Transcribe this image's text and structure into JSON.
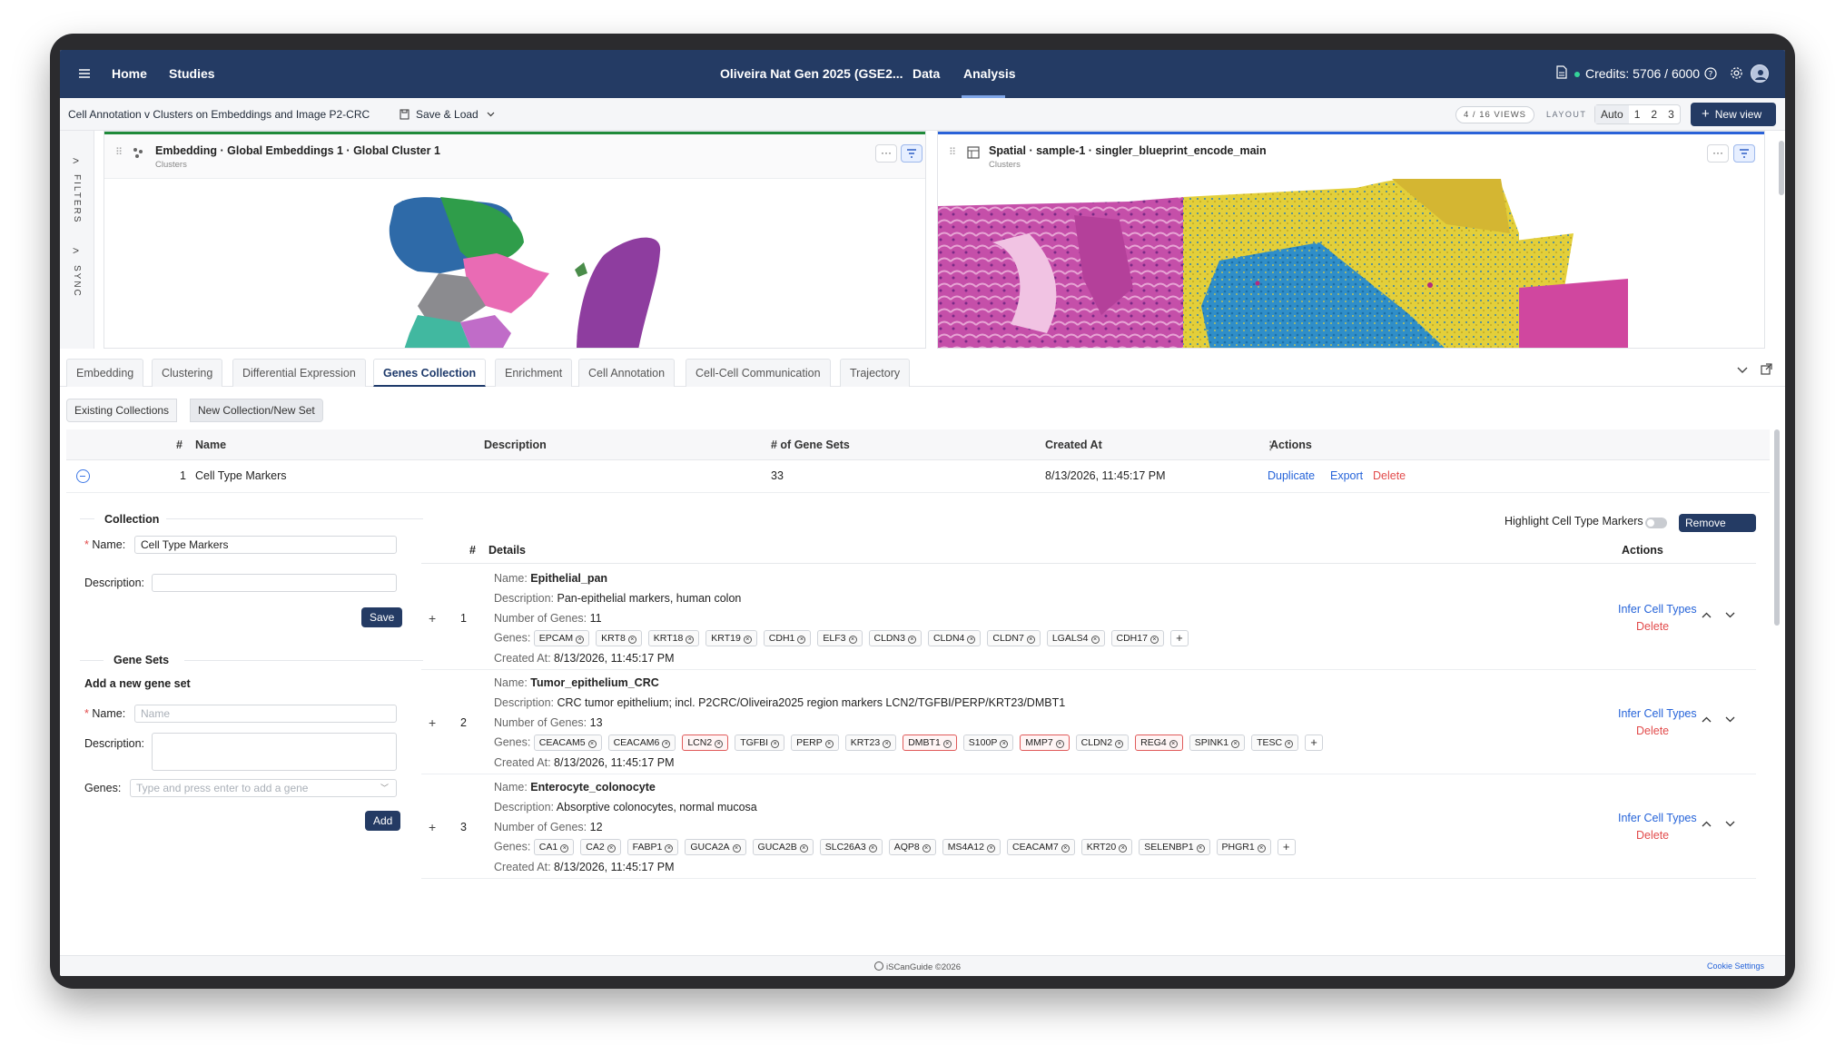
{
  "nav": {
    "home": "Home",
    "studies": "Studies",
    "project": "Oliveira Nat Gen 2025 (GSE2...",
    "data": "Data",
    "analysis": "Analysis",
    "credits": "Credits: 5706 / 6000"
  },
  "subheader": {
    "title": "Cell Annotation v Clusters on Embeddings and Image P2-CRC",
    "save_load": "Save & Load",
    "views": "4 / 16 VIEWS",
    "layout_label": "LAYOUT",
    "layout_options": [
      "Auto",
      "1",
      "2",
      "3"
    ],
    "new_view": "New view"
  },
  "rail": {
    "filters": "FILTERS",
    "sync": "SYNC"
  },
  "panels": [
    {
      "title": "Embedding · Global Embeddings 1 · Global Cluster 1",
      "subtitle": "Clusters",
      "accent": "#1f8a3a"
    },
    {
      "title": "Spatial · sample-1 · singler_blueprint_encode_main",
      "subtitle": "Clusters",
      "accent": "#2a62d8"
    }
  ],
  "tabs": [
    "Embedding",
    "Clustering",
    "Differential Expression",
    "Genes Collection",
    "Enrichment",
    "Cell Annotation",
    "Cell-Cell Communication",
    "Trajectory"
  ],
  "active_tab": "Genes Collection",
  "segments": [
    "Existing Collections",
    "New Collection/New Set"
  ],
  "table": {
    "headers": [
      "#",
      "Name",
      "Description",
      "# of Gene Sets",
      "Created At",
      "Actions"
    ],
    "row": {
      "index": "1",
      "name": "Cell Type Markers",
      "description": "",
      "gene_sets": "33",
      "created": "8/13/2026, 11:45:17 PM",
      "actions": [
        "Duplicate",
        "Export",
        "Delete"
      ]
    }
  },
  "form": {
    "collection_heading": "Collection",
    "name_label": "Name",
    "name_value": "Cell Type Markers",
    "description_label": "Description",
    "save": "Save",
    "gene_sets_heading": "Gene Sets",
    "add_heading": "Add a new gene set",
    "new_name_label": "Name",
    "new_name_placeholder": "Name",
    "new_description_label": "Description",
    "genes_label": "Genes",
    "genes_placeholder": "Type and press enter to add a gene",
    "add": "Add"
  },
  "genesets": {
    "highlight_label": "Highlight Cell Type Markers",
    "remove_duplicates": "Remove duplicates",
    "headers": {
      "index": "#",
      "details": "Details",
      "actions": "Actions"
    },
    "keys": {
      "name": "Name",
      "description": "Description",
      "number": "Number of Genes",
      "genes": "Genes",
      "created": "Created At"
    },
    "infer": "Infer Cell Types",
    "delete": "Delete",
    "items": [
      {
        "index": "1",
        "name": "Epithelial_pan",
        "description": "Pan-epithelial markers, human colon",
        "number": "11",
        "created": "8/13/2026, 11:45:17 PM",
        "genes": [
          {
            "g": "EPCAM",
            "hl": false
          },
          {
            "g": "KRT8",
            "hl": false
          },
          {
            "g": "KRT18",
            "hl": false
          },
          {
            "g": "KRT19",
            "hl": false
          },
          {
            "g": "CDH1",
            "hl": false
          },
          {
            "g": "ELF3",
            "hl": false
          },
          {
            "g": "CLDN3",
            "hl": false
          },
          {
            "g": "CLDN4",
            "hl": false
          },
          {
            "g": "CLDN7",
            "hl": false
          },
          {
            "g": "LGALS4",
            "hl": false
          },
          {
            "g": "CDH17",
            "hl": false
          }
        ]
      },
      {
        "index": "2",
        "name": "Tumor_epithelium_CRC",
        "description": "CRC tumor epithelium; incl. P2CRC/Oliveira2025 region markers LCN2/TGFBI/PERP/KRT23/DMBT1",
        "number": "13",
        "created": "8/13/2026, 11:45:17 PM",
        "genes": [
          {
            "g": "CEACAM5",
            "hl": false
          },
          {
            "g": "CEACAM6",
            "hl": false
          },
          {
            "g": "LCN2",
            "hl": true
          },
          {
            "g": "TGFBI",
            "hl": false
          },
          {
            "g": "PERP",
            "hl": false
          },
          {
            "g": "KRT23",
            "hl": false
          },
          {
            "g": "DMBT1",
            "hl": true
          },
          {
            "g": "S100P",
            "hl": false
          },
          {
            "g": "MMP7",
            "hl": true
          },
          {
            "g": "CLDN2",
            "hl": false
          },
          {
            "g": "REG4",
            "hl": true
          },
          {
            "g": "SPINK1",
            "hl": false
          },
          {
            "g": "TESC",
            "hl": false
          }
        ]
      },
      {
        "index": "3",
        "name": "Enterocyte_colonocyte",
        "description": "Absorptive colonocytes, normal mucosa",
        "number": "12",
        "created": "8/13/2026, 11:45:17 PM",
        "genes": [
          {
            "g": "CA1",
            "hl": false
          },
          {
            "g": "CA2",
            "hl": false
          },
          {
            "g": "FABP1",
            "hl": false
          },
          {
            "g": "GUCA2A",
            "hl": false
          },
          {
            "g": "GUCA2B",
            "hl": false
          },
          {
            "g": "SLC26A3",
            "hl": false
          },
          {
            "g": "AQP8",
            "hl": false
          },
          {
            "g": "MS4A12",
            "hl": false
          },
          {
            "g": "CEACAM7",
            "hl": false
          },
          {
            "g": "KRT20",
            "hl": false
          },
          {
            "g": "SELENBP1",
            "hl": false
          },
          {
            "g": "PHGR1",
            "hl": false
          }
        ]
      }
    ]
  },
  "footer": {
    "copyright": "iSCanGuide ©2026",
    "cookies": "Cookie Settings"
  }
}
